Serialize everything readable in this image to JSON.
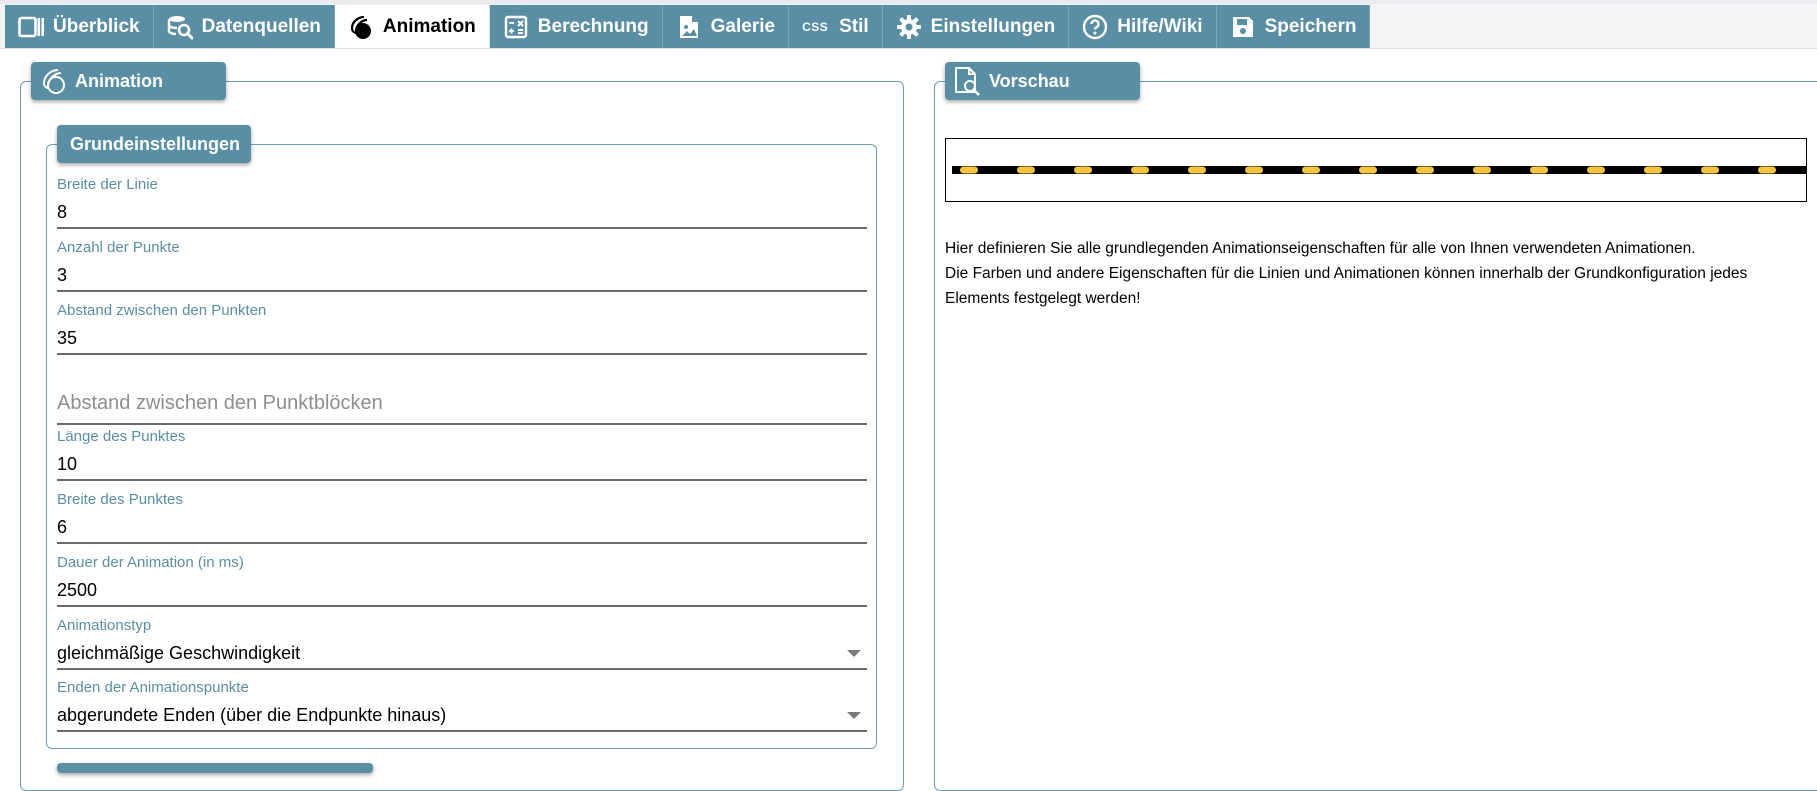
{
  "tabs": [
    {
      "label": "Überblick",
      "icon": "overview-icon"
    },
    {
      "label": "Datenquellen",
      "icon": "datasource-search-icon"
    },
    {
      "label": "Animation",
      "icon": "animation-icon",
      "active": true
    },
    {
      "label": "Berechnung",
      "icon": "calculator-icon"
    },
    {
      "label": "Galerie",
      "icon": "gallery-icon"
    },
    {
      "label": "Stil",
      "icon": "css-icon",
      "icon_text": "CSS"
    },
    {
      "label": "Einstellungen",
      "icon": "gear-icon"
    },
    {
      "label": "Hilfe/Wiki",
      "icon": "help-icon"
    },
    {
      "label": "Speichern",
      "icon": "save-icon"
    }
  ],
  "animation_panel": {
    "title": "Animation",
    "basic_settings": {
      "title": "Grundeinstellungen",
      "fields": {
        "line_width": {
          "label": "Breite der Linie",
          "value": "8"
        },
        "dot_count": {
          "label": "Anzahl der Punkte",
          "value": "3"
        },
        "dot_spacing": {
          "label": "Abstand zwischen den Punkten",
          "value": "35"
        },
        "block_spacing": {
          "placeholder": "Abstand zwischen den Punktblöcken",
          "value": ""
        },
        "dot_length": {
          "label": "Länge des Punktes",
          "value": "10"
        },
        "dot_width": {
          "label": "Breite des Punktes",
          "value": "6"
        },
        "duration": {
          "label": "Dauer der Animation (in ms)",
          "value": "2500"
        },
        "anim_type": {
          "label": "Animationstyp",
          "value": "gleichmäßige Geschwindigkeit"
        },
        "dot_ends": {
          "label": "Enden der Animationspunkte",
          "value": "abgerundete Enden (über die Endpunkte hinaus)"
        }
      }
    }
  },
  "preview_panel": {
    "title": "Vorschau",
    "line_color": "#000000",
    "dot_color": "#f5c342",
    "description_line1": "Hier definieren Sie alle grundlegenden Animationseigenschaften für alle von Ihnen verwendeten Animationen.",
    "description_line2": "Die Farben und andere Eigenschaften für die Linien und Animationen können innerhalb der Grundkonfiguration jedes Elements festgelegt werden!"
  },
  "colors": {
    "accent": "#5a8ea4",
    "accent_border": "#6c9fb3"
  }
}
